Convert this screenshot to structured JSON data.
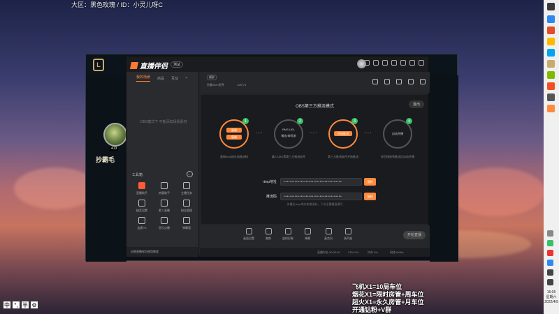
{
  "overlay": {
    "stream_title": "大区：黑色玫瑰 / ID：小灵儿呀C",
    "ad_lines": [
      "飞机X1=10局车位",
      "烟花X1=限时房管+周车位",
      "超火X1=永久房管+月车位",
      "开通钻粉+V群"
    ],
    "ime_buttons": [
      "中",
      "°,",
      "半",
      "⚙"
    ]
  },
  "taskbar": {
    "clock_time": "16:05",
    "clock_day": "星期六",
    "clock_date": "2022/4/9"
  },
  "game": {
    "logo": "L",
    "champion_name": "抄霸毛",
    "champion_level": "413"
  },
  "app": {
    "name": "直播伴侣",
    "version": "测试",
    "left_tabs": [
      "我的场景",
      "商品",
      "互动"
    ],
    "empty_scene_text": "OBS模式下 不能添加场景素材",
    "tools_title": "工具箱",
    "tools": [
      {
        "label": "直播助手",
        "hot": true
      },
      {
        "label": "房管助手",
        "hot": false
      },
      {
        "label": "主播任务",
        "hot": false
      },
      {
        "label": "抽奖设置",
        "hot": false
      },
      {
        "label": "素人直播",
        "hot": false
      },
      {
        "label": "粉丝管理",
        "hot": false
      },
      {
        "label": "连麦PK",
        "hot": false
      },
      {
        "label": "音乐点播",
        "hot": false
      },
      {
        "label": "弹幕墙",
        "hot": false
      }
    ],
    "footer_text": "出售直播伴侣使用教程",
    "room_tag": "横屏",
    "room_name": "抄霸Jhen灵界",
    "room_hot": "128771",
    "obs": {
      "title": "OBS第三方推流模式",
      "exit_label": "退出",
      "steps": [
        {
          "num": "1",
          "btn1": "复制",
          "btn2": "复制",
          "desc": "复制rtmp地址和推流码"
        },
        {
          "num": "2",
          "line1": "RMS URL",
          "line2": "输出/串码流",
          "desc": "填入OBS等第三方推流软件"
        },
        {
          "num": "3",
          "btn1": "开始推流",
          "desc": "第三方推流软件开始推流"
        },
        {
          "num": "4",
          "line1": "自动开播",
          "desc": "伴侣接收到推流后自动开播"
        }
      ],
      "rtmp_label": "rtmp地址",
      "rtmp_value": "•••••••••••••••••••••••••••••••••••••",
      "key_label": "推流码",
      "key_value": "•••••••••••••••••••••••••••••••••••••",
      "copy_label": "复制",
      "hint": "关播后rtmp地址和推流码，下次无需重复填写"
    },
    "bottom_tools": [
      "画面设置",
      "美颜",
      "虚拟形象",
      "弹幕",
      "麦克风",
      "扬声器"
    ],
    "start_label": "开始直播",
    "status": [
      "直播时长 00:00:00",
      "CPU 0%",
      "内存 0%",
      "网络 0KB/s"
    ]
  }
}
